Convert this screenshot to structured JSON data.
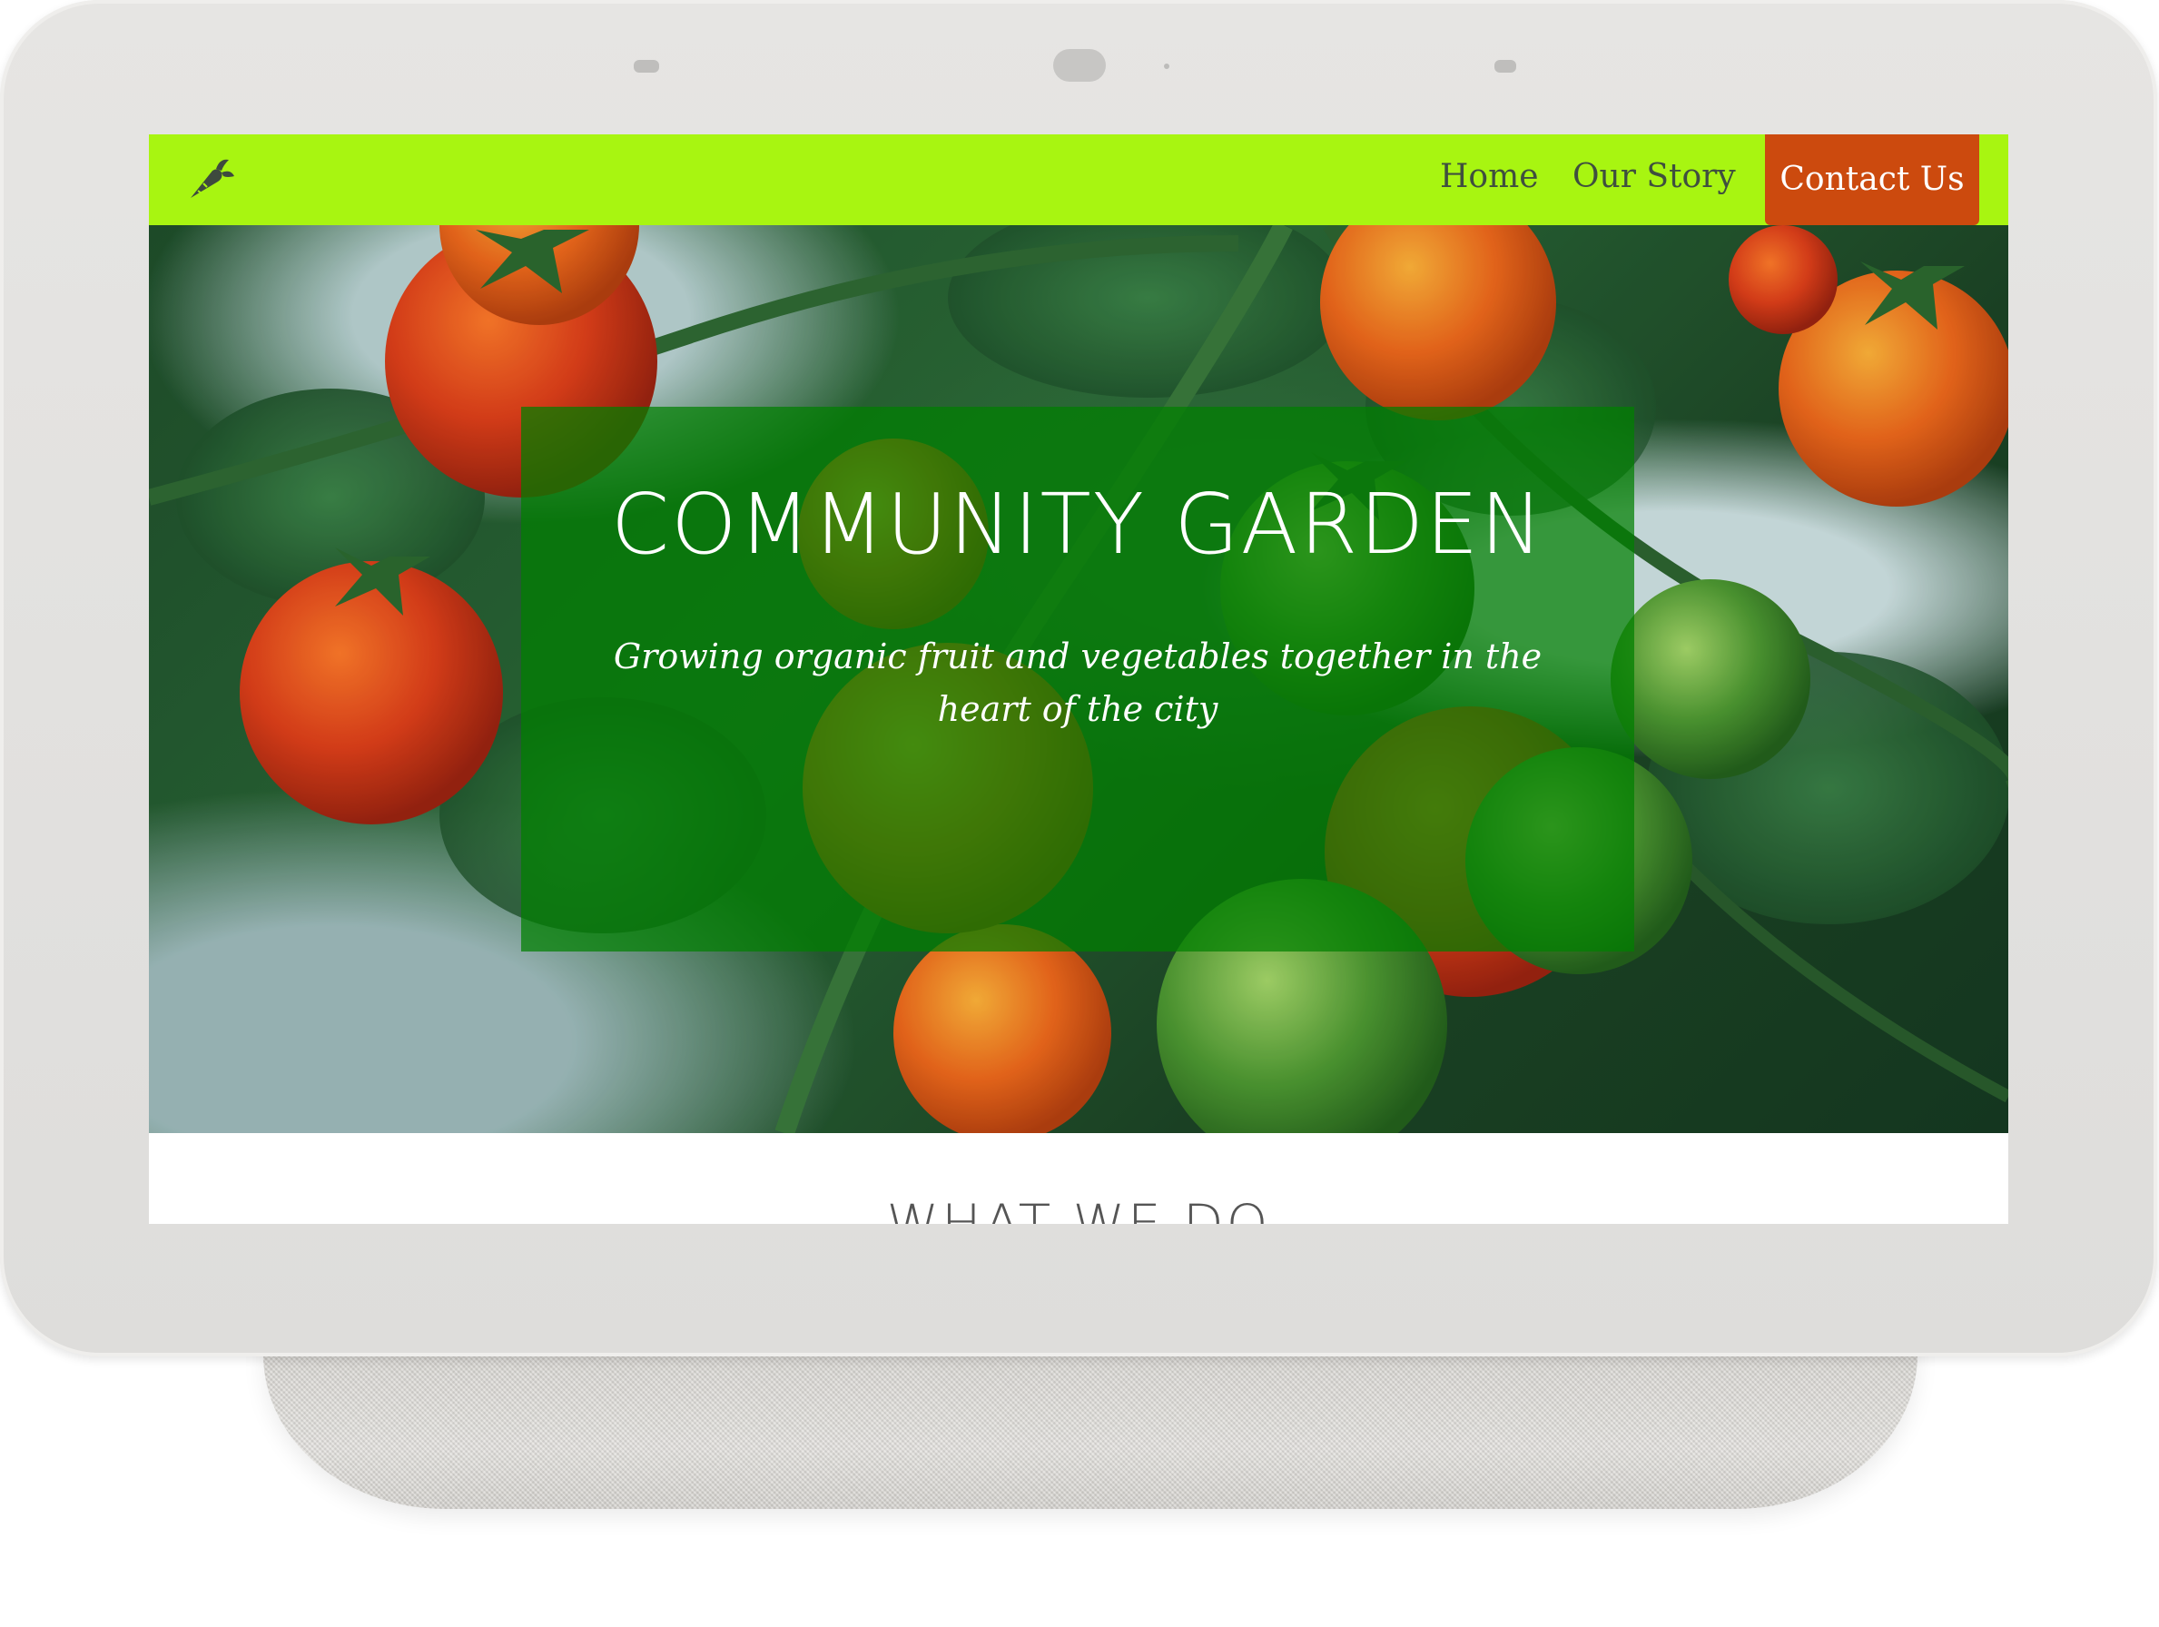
{
  "nav": {
    "logo_icon": "carrot-icon",
    "home": "Home",
    "our_story": "Our Story",
    "contact": "Contact Us"
  },
  "hero": {
    "title": "COMMUNITY GARDEN",
    "subtitle": "Growing organic fruit and vegetables together in the heart of the city",
    "background": "tomato plants photo"
  },
  "section": {
    "heading": "WHAT WE DO"
  },
  "colors": {
    "nav_background": "#a8f511",
    "contact_button": "#cc4a0e",
    "hero_overlay": "#008000",
    "device_frame": "#e2e1df"
  }
}
